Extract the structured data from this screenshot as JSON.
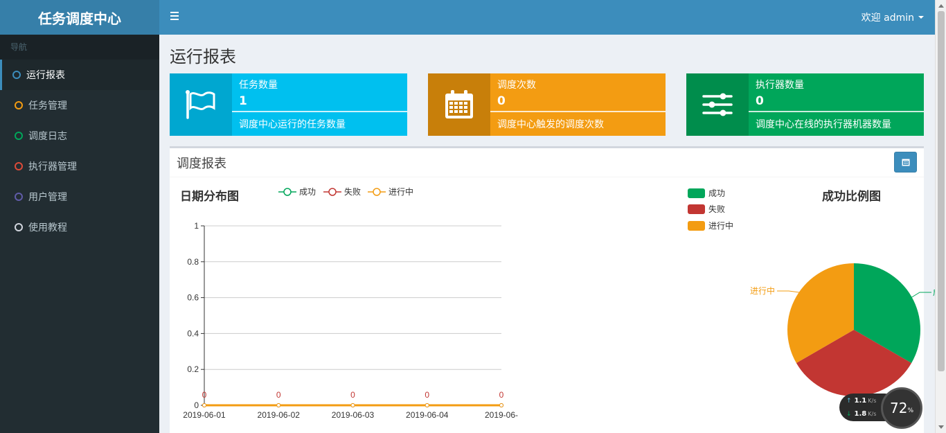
{
  "app": {
    "title": "任务调度中心"
  },
  "header": {
    "welcome": "欢迎 admin"
  },
  "sidebar": {
    "header": "导航",
    "items": [
      {
        "label": "运行报表",
        "color": "#3c8dbc"
      },
      {
        "label": "任务管理",
        "color": "#f39c12"
      },
      {
        "label": "调度日志",
        "color": "#00a65a"
      },
      {
        "label": "执行器管理",
        "color": "#dd4b39"
      },
      {
        "label": "用户管理",
        "color": "#605ca8"
      },
      {
        "label": "使用教程",
        "color": "#d2d6de"
      }
    ]
  },
  "page": {
    "title": "运行报表"
  },
  "info_boxes": [
    {
      "label": "任务数量",
      "number": "1",
      "desc": "调度中心运行的任务数量",
      "icon": "flag-icon",
      "color": "#00c0ef",
      "icon_bg": "#00a7d0"
    },
    {
      "label": "调度次数",
      "number": "0",
      "desc": "调度中心触发的调度次数",
      "icon": "calendar-icon",
      "color": "#f39c12",
      "icon_bg": "#c87f0a"
    },
    {
      "label": "执行器数量",
      "number": "0",
      "desc": "调度中心在线的执行器机器数量",
      "icon": "sliders-icon",
      "color": "#00a65a",
      "icon_bg": "#008d4c"
    }
  ],
  "report": {
    "title": "调度报表",
    "line_chart_title": "日期分布图",
    "pie_chart_title": "成功比例图",
    "legend": [
      "成功",
      "失败",
      "进行中"
    ]
  },
  "chart_data": [
    {
      "type": "line",
      "title": "日期分布图",
      "x": [
        "2019-06-01",
        "2019-06-02",
        "2019-06-03",
        "2019-06-04",
        "2019-06-"
      ],
      "y_ticks": [
        "0",
        "0.2",
        "0.4",
        "0.6",
        "0.8",
        "1"
      ],
      "ylim": [
        0,
        1
      ],
      "grid": true,
      "legend": "top",
      "series": [
        {
          "name": "成功",
          "color": "#00a65a",
          "values": [
            0,
            0,
            0,
            0,
            0
          ]
        },
        {
          "name": "失败",
          "color": "#c23632",
          "values": [
            0,
            0,
            0,
            0,
            0
          ]
        },
        {
          "name": "进行中",
          "color": "#f39c12",
          "values": [
            0,
            0,
            0,
            0,
            0
          ]
        }
      ],
      "data_labels": [
        "0",
        "0",
        "0",
        "0",
        "0"
      ]
    },
    {
      "type": "pie",
      "title": "成功比例图",
      "legend": "top-left",
      "slices": [
        {
          "name": "成功",
          "color": "#00a65a",
          "value": 1
        },
        {
          "name": "失败",
          "color": "#c23632",
          "value": 1
        },
        {
          "name": "进行中",
          "color": "#f39c12",
          "value": 1
        }
      ],
      "slice_labels": [
        "进行中",
        "成"
      ]
    }
  ],
  "widget": {
    "up_value": "1.1",
    "up_unit": "K/s",
    "down_value": "1.8",
    "down_unit": "K/s",
    "percent": "72",
    "percent_sign": "%"
  }
}
